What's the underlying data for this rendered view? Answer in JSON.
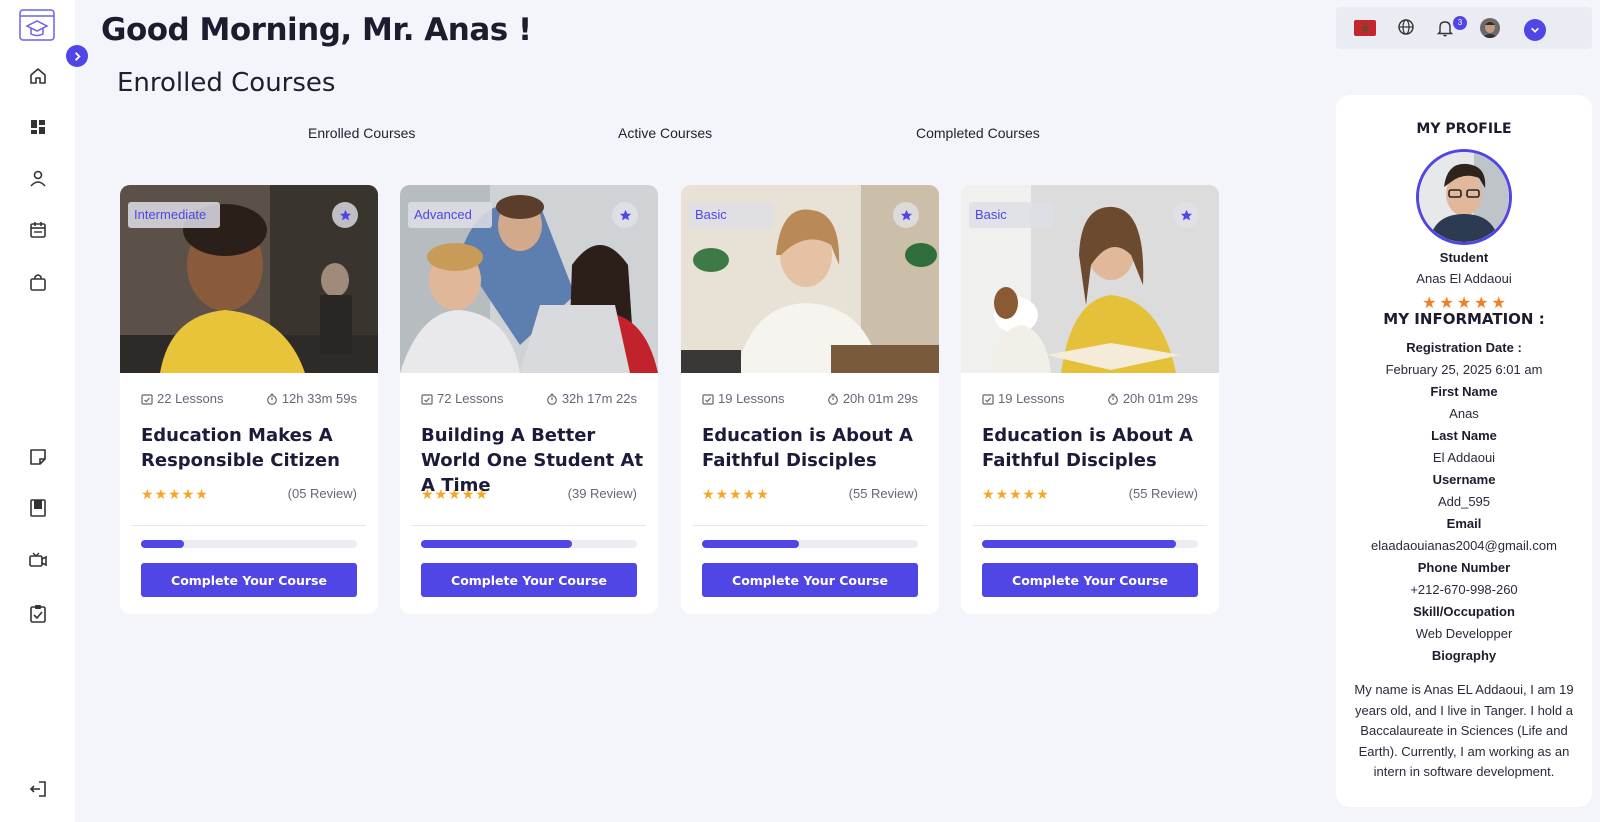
{
  "greeting": "Good Morning, Mr. Anas !",
  "section_title": "Enrolled Courses",
  "tabs": [
    "Enrolled Courses",
    "Active Courses",
    "Completed Courses"
  ],
  "sidebar": {
    "logo": "graduation-cap-logo",
    "items": [
      "home-icon",
      "dashboard-icon",
      "user-icon",
      "calendar-icon",
      "shopping-bag-icon",
      "note-icon",
      "book-icon",
      "video-icon",
      "clipboard-check-icon"
    ],
    "logout": "logout-icon"
  },
  "topbar": {
    "flag": "morocco-flag",
    "notifications_count": "3"
  },
  "courses": [
    {
      "level": "Intermediate",
      "lessons": "22 Lessons",
      "duration": "12h 33m 59s",
      "title": "Education Makes A Responsible Citizen",
      "rating": 5,
      "reviews": "(05 Review)",
      "progress": 0.2,
      "cta": "Complete Your Course"
    },
    {
      "level": "Advanced",
      "lessons": "72 Lessons",
      "duration": "32h 17m 22s",
      "title": "Building A Better World One Student At A Time",
      "rating": 5,
      "reviews": "(39 Review)",
      "progress": 0.7,
      "cta": "Complete Your Course"
    },
    {
      "level": "Basic",
      "lessons": "19 Lessons",
      "duration": "20h 01m 29s",
      "title": "Education is About A Faithful Disciples",
      "rating": 5,
      "reviews": "(55 Review)",
      "progress": 0.45,
      "cta": "Complete Your Course"
    },
    {
      "level": "Basic",
      "lessons": "19 Lessons",
      "duration": "20h 01m 29s",
      "title": "Education is About A Faithful Disciples",
      "rating": 5,
      "reviews": "(55 Review)",
      "progress": 0.9,
      "cta": "Complete Your Course"
    }
  ],
  "profile": {
    "heading": "MY PROFILE",
    "role": "Student",
    "name": "Anas El Addaoui",
    "rating": 5,
    "info_heading": "MY INFORMATION :",
    "fields": [
      {
        "label": "Registration Date :",
        "value": "February 25, 2025 6:01 am"
      },
      {
        "label": "First Name",
        "value": "Anas"
      },
      {
        "label": "Last Name",
        "value": "El Addaoui"
      },
      {
        "label": "Username",
        "value": "Add_595"
      },
      {
        "label": "Email",
        "value": "elaadaouianas2004@gmail.com"
      },
      {
        "label": "Phone Number",
        "value": "+212-670-998-260"
      },
      {
        "label": "Skill/Occupation",
        "value": "Web Developper"
      }
    ],
    "bio_label": "Biography",
    "bio": "My name is Anas EL Addaoui, I am 19 years old, and I live in Tanger. I hold a Baccalaureate in Sciences (Life and Earth). Currently, I am working as an intern in software development."
  },
  "colors": {
    "accent": "#4f46e5",
    "star": "#f5a623",
    "profile_star": "#f57c20",
    "background": "#f4f5fa"
  }
}
